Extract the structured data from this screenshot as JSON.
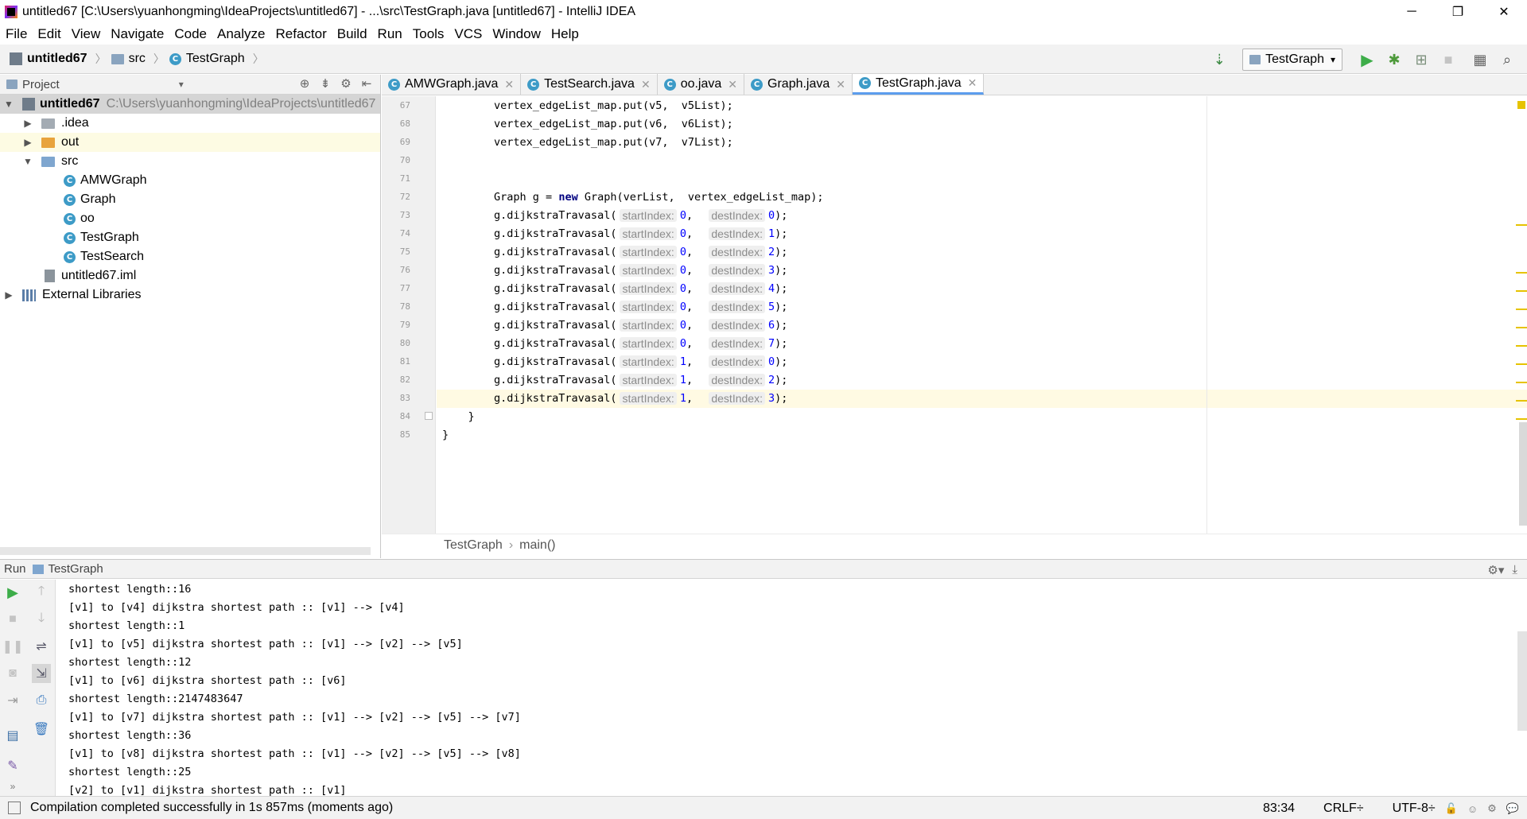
{
  "window": {
    "title": "untitled67 [C:\\Users\\yuanhongming\\IdeaProjects\\untitled67] - ...\\src\\TestGraph.java [untitled67] - IntelliJ IDEA",
    "controls": [
      "─",
      "❐",
      "✕"
    ]
  },
  "menu": [
    "File",
    "Edit",
    "View",
    "Navigate",
    "Code",
    "Analyze",
    "Refactor",
    "Build",
    "Run",
    "Tools",
    "VCS",
    "Window",
    "Help"
  ],
  "nav": {
    "breadcrumb": [
      "untitled67",
      "src",
      "TestGraph"
    ],
    "run_config": "TestGraph"
  },
  "project": {
    "header": "Project",
    "tree": [
      {
        "label": "untitled67",
        "path": "C:\\Users\\yuanhongming\\IdeaProjects\\untitled67",
        "icon": "project-folder-icon",
        "expanded": true
      },
      {
        "label": ".idea",
        "icon": "folder-icon",
        "expanded": false
      },
      {
        "label": "out",
        "icon": "excluded-folder-icon",
        "expanded": false
      },
      {
        "label": "src",
        "icon": "source-folder-icon",
        "expanded": true
      },
      {
        "label": "AMWGraph",
        "icon": "java-class-icon"
      },
      {
        "label": "Graph",
        "icon": "java-class-icon"
      },
      {
        "label": "oo",
        "icon": "java-class-icon"
      },
      {
        "label": "TestGraph",
        "icon": "java-class-icon"
      },
      {
        "label": "TestSearch",
        "icon": "java-class-icon"
      },
      {
        "label": "untitled67.iml",
        "icon": "module-file-icon"
      },
      {
        "label": "External Libraries",
        "icon": "library-icon",
        "expanded": false
      }
    ]
  },
  "tabs": [
    {
      "label": "AMWGraph.java",
      "active": false
    },
    {
      "label": "TestSearch.java",
      "active": false
    },
    {
      "label": "oo.java",
      "active": false
    },
    {
      "label": "Graph.java",
      "active": false
    },
    {
      "label": "TestGraph.java",
      "active": true
    }
  ],
  "editor": {
    "lines": [
      {
        "num": "67",
        "segments": [
          {
            "t": "        vertex_edgeList_map.put(v5,  v5List);"
          }
        ]
      },
      {
        "num": "68",
        "segments": [
          {
            "t": "        vertex_edgeList_map.put(v6,  v6List);"
          }
        ]
      },
      {
        "num": "69",
        "segments": [
          {
            "t": "        vertex_edgeList_map.put(v7,  v7List);"
          }
        ]
      },
      {
        "num": "70",
        "segments": []
      },
      {
        "num": "71",
        "segments": []
      },
      {
        "num": "72",
        "segments": [
          {
            "t": "        Graph g = "
          },
          {
            "t": "new",
            "k": "kw"
          },
          {
            "t": " Graph(verList,  vertex_edgeList_map);"
          }
        ]
      },
      {
        "num": "73",
        "segments": [
          {
            "t": "        g.dijkstraTravasal("
          },
          {
            "h": "startIndex:"
          },
          {
            "t": "0",
            "k": "num"
          },
          {
            "t": ",  "
          },
          {
            "h": "destIndex:"
          },
          {
            "t": "0",
            "k": "num"
          },
          {
            "t": ");"
          }
        ]
      },
      {
        "num": "74",
        "segments": [
          {
            "t": "        g.dijkstraTravasal("
          },
          {
            "h": "startIndex:"
          },
          {
            "t": "0",
            "k": "num"
          },
          {
            "t": ",  "
          },
          {
            "h": "destIndex:"
          },
          {
            "t": "1",
            "k": "num"
          },
          {
            "t": ");"
          }
        ]
      },
      {
        "num": "75",
        "segments": [
          {
            "t": "        g.dijkstraTravasal("
          },
          {
            "h": "startIndex:"
          },
          {
            "t": "0",
            "k": "num"
          },
          {
            "t": ",  "
          },
          {
            "h": "destIndex:"
          },
          {
            "t": "2",
            "k": "num"
          },
          {
            "t": ");"
          }
        ]
      },
      {
        "num": "76",
        "segments": [
          {
            "t": "        g.dijkstraTravasal("
          },
          {
            "h": "startIndex:"
          },
          {
            "t": "0",
            "k": "num"
          },
          {
            "t": ",  "
          },
          {
            "h": "destIndex:"
          },
          {
            "t": "3",
            "k": "num"
          },
          {
            "t": ");"
          }
        ]
      },
      {
        "num": "77",
        "segments": [
          {
            "t": "        g.dijkstraTravasal("
          },
          {
            "h": "startIndex:"
          },
          {
            "t": "0",
            "k": "num"
          },
          {
            "t": ",  "
          },
          {
            "h": "destIndex:"
          },
          {
            "t": "4",
            "k": "num"
          },
          {
            "t": ");"
          }
        ]
      },
      {
        "num": "78",
        "segments": [
          {
            "t": "        g.dijkstraTravasal("
          },
          {
            "h": "startIndex:"
          },
          {
            "t": "0",
            "k": "num"
          },
          {
            "t": ",  "
          },
          {
            "h": "destIndex:"
          },
          {
            "t": "5",
            "k": "num"
          },
          {
            "t": ");"
          }
        ]
      },
      {
        "num": "79",
        "segments": [
          {
            "t": "        g.dijkstraTravasal("
          },
          {
            "h": "startIndex:"
          },
          {
            "t": "0",
            "k": "num"
          },
          {
            "t": ",  "
          },
          {
            "h": "destIndex:"
          },
          {
            "t": "6",
            "k": "num"
          },
          {
            "t": ");"
          }
        ]
      },
      {
        "num": "80",
        "segments": [
          {
            "t": "        g.dijkstraTravasal("
          },
          {
            "h": "startIndex:"
          },
          {
            "t": "0",
            "k": "num"
          },
          {
            "t": ",  "
          },
          {
            "h": "destIndex:"
          },
          {
            "t": "7",
            "k": "num"
          },
          {
            "t": ");"
          }
        ]
      },
      {
        "num": "81",
        "segments": [
          {
            "t": "        g.dijkstraTravasal("
          },
          {
            "h": "startIndex:"
          },
          {
            "t": "1",
            "k": "num"
          },
          {
            "t": ",  "
          },
          {
            "h": "destIndex:"
          },
          {
            "t": "0",
            "k": "num"
          },
          {
            "t": ");"
          }
        ]
      },
      {
        "num": "82",
        "segments": [
          {
            "t": "        g.dijkstraTravasal("
          },
          {
            "h": "startIndex:"
          },
          {
            "t": "1",
            "k": "num"
          },
          {
            "t": ",  "
          },
          {
            "h": "destIndex:"
          },
          {
            "t": "2",
            "k": "num"
          },
          {
            "t": ");"
          }
        ]
      },
      {
        "num": "83",
        "segments": [
          {
            "t": "        g.dijkstraTravasal("
          },
          {
            "h": "startIndex:"
          },
          {
            "t": "1",
            "k": "num"
          },
          {
            "t": ",  "
          },
          {
            "h": "destIndex:"
          },
          {
            "t": "3",
            "k": "num"
          },
          {
            "t": ");"
          }
        ],
        "current": true
      },
      {
        "num": "84",
        "segments": [
          {
            "t": "    }"
          }
        ]
      },
      {
        "num": "85",
        "segments": [
          {
            "t": "}"
          }
        ]
      }
    ],
    "breadcrumb": [
      "TestGraph",
      "main()"
    ]
  },
  "run_panel": {
    "label": "Run",
    "config": "TestGraph",
    "console": [
      "shortest length::16",
      "[v1] to [v4] dijkstra shortest path :: [v1] --> [v4]",
      "shortest length::1",
      "[v1] to [v5] dijkstra shortest path :: [v1] --> [v2] --> [v5]",
      "shortest length::12",
      "[v1] to [v6] dijkstra shortest path :: [v6]",
      "shortest length::2147483647",
      "[v1] to [v7] dijkstra shortest path :: [v1] --> [v2] --> [v5] --> [v7]",
      "shortest length::36",
      "[v1] to [v8] dijkstra shortest path :: [v1] --> [v2] --> [v5] --> [v8]",
      "shortest length::25",
      "[v2] to [v1] dijkstra shortest path :: [v1]"
    ]
  },
  "status": {
    "message": "Compilation completed successfully in 1s 857ms (moments ago)",
    "position": "83:34",
    "line_sep": "CRLF",
    "encoding": "UTF-8"
  },
  "colors": {
    "accent": "#5c9ded",
    "keyword": "#000080",
    "number": "#0000ff",
    "warning_stripe": "#e6c300",
    "run_green": "#3dad49"
  }
}
